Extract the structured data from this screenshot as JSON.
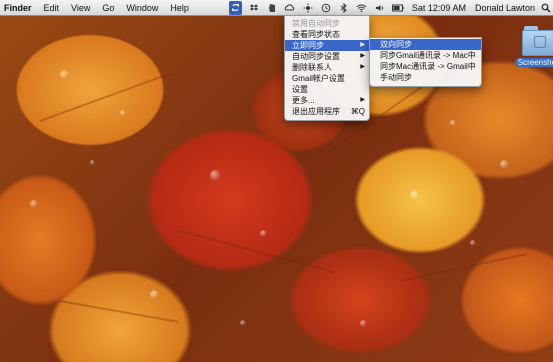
{
  "menubar": {
    "app_name": "Finder",
    "menus": [
      "Edit",
      "View",
      "Go",
      "Window",
      "Help"
    ],
    "status_icons": [
      "sync-icon",
      "dropbox-icon",
      "evernote-icon",
      "cloud-icon",
      "sun-icon",
      "time-machine-icon",
      "bluetooth-icon",
      "wifi-icon",
      "volume-icon",
      "battery-icon"
    ],
    "clock": "Sat 12:09 AM",
    "user_name": "Donald Lawton"
  },
  "dropdown": {
    "items": [
      {
        "label": "禁用自动同步",
        "disabled": true,
        "submenu": false,
        "shortcut": ""
      },
      {
        "label": "查看同步状态",
        "disabled": false,
        "submenu": false,
        "shortcut": ""
      },
      {
        "label": "立即同步",
        "disabled": false,
        "submenu": true,
        "highlight": true,
        "shortcut": ""
      },
      {
        "label": "自动同步设置",
        "disabled": false,
        "submenu": true,
        "shortcut": ""
      },
      {
        "label": "删除联系人",
        "disabled": false,
        "submenu": true,
        "shortcut": ""
      },
      {
        "label": "Gmail帐户设置",
        "disabled": false,
        "submenu": false,
        "shortcut": ""
      },
      {
        "label": "设置",
        "disabled": false,
        "submenu": false,
        "shortcut": ""
      },
      {
        "label": "更多...",
        "disabled": false,
        "submenu": true,
        "shortcut": ""
      },
      {
        "label": "退出应用程序",
        "disabled": false,
        "submenu": false,
        "shortcut": "⌘Q"
      }
    ]
  },
  "submenu": {
    "items": [
      {
        "label": "双向同步",
        "highlight": true
      },
      {
        "label": "同步Gmail通讯录 -> Mac中",
        "highlight": false
      },
      {
        "label": "同步Mac通讯录 -> Gmail中",
        "highlight": false
      },
      {
        "label": "手动同步",
        "highlight": false
      }
    ]
  },
  "desktop": {
    "folder_label": "Screenshots"
  },
  "colors": {
    "menu_highlight": "#3b66c9",
    "menubar_bg": "#e8e8e8"
  }
}
